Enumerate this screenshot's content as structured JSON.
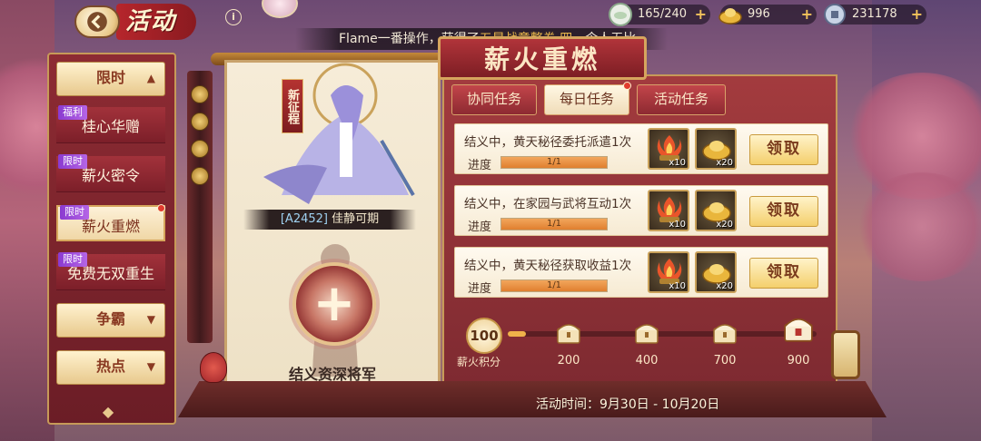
{
  "header": {
    "title": "活动",
    "info_symbol": "i"
  },
  "resources": [
    {
      "icon": "stamina-icon",
      "value": "165/240"
    },
    {
      "icon": "gold-ingot-icon",
      "value": "996"
    },
    {
      "icon": "silver-coin-icon",
      "value": "231178"
    }
  ],
  "ticker": {
    "prefix": "Flame一番操作，获得了",
    "highlight": "五星战意整卷·四",
    "suffix": "，令人无比"
  },
  "sidebar": {
    "group_limited": "限时",
    "group_compete": "争霸",
    "group_hot": "热点",
    "items": [
      {
        "tag": "福利",
        "label": "桂心华赠",
        "active": false
      },
      {
        "tag": "限时",
        "label": "薪火密令",
        "active": false
      },
      {
        "tag": "限时",
        "label": "薪火重燃",
        "active": true
      },
      {
        "tag": "限时",
        "label": "免费无双重生",
        "active": false
      }
    ]
  },
  "character": {
    "tag": "新征程",
    "code": "[A2452]",
    "name": "佳静可期",
    "recruit_symbol": "+",
    "recruit_label": "结义资深将军"
  },
  "main": {
    "title": "薪火重燃",
    "tabs": [
      {
        "label": "协同任务",
        "active": false
      },
      {
        "label": "每日任务",
        "active": true
      },
      {
        "label": "活动任务",
        "active": false
      }
    ],
    "tasks": [
      {
        "desc": "结义中，黄天秘径委托派遣1次",
        "progress_label": "进度",
        "progress_text": "1/1",
        "progress": 1.0,
        "rewards": [
          {
            "icon": "fire-basin-icon",
            "count": "x10"
          },
          {
            "icon": "gold-ingot-icon",
            "count": "x20"
          }
        ],
        "claim_label": "领取"
      },
      {
        "desc": "结义中，在家园与武将互动1次",
        "progress_label": "进度",
        "progress_text": "1/1",
        "progress": 1.0,
        "rewards": [
          {
            "icon": "fire-basin-icon",
            "count": "x10"
          },
          {
            "icon": "gold-ingot-icon",
            "count": "x20"
          }
        ],
        "claim_label": "领取"
      },
      {
        "desc": "结义中，黄天秘径获取收益1次",
        "progress_label": "进度",
        "progress_text": "1/1",
        "progress": 1.0,
        "rewards": [
          {
            "icon": "fire-basin-icon",
            "count": "x10"
          },
          {
            "icon": "gold-ingot-icon",
            "count": "x20"
          }
        ],
        "claim_label": "领取"
      }
    ],
    "score": {
      "value": "100",
      "label": "薪火积分",
      "progress": 0.06,
      "milestones": [
        "200",
        "400",
        "700",
        "900"
      ]
    },
    "event_time": "活动时间：9月30日 - 10月20日"
  },
  "colors": {
    "accent_red": "#a33b3e",
    "gold": "#f0b24a",
    "cream": "#fff7e4"
  }
}
